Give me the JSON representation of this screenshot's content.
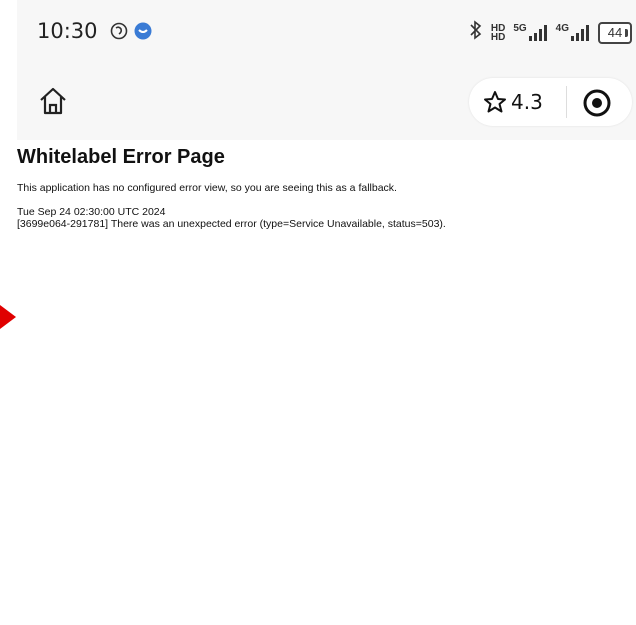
{
  "status_bar": {
    "time": "10:30",
    "hd_top": "HD",
    "hd_bottom": "HD",
    "network_5g": "5G",
    "network_4g": "4G",
    "battery": "44"
  },
  "toolbar": {
    "rating": "4.3"
  },
  "page": {
    "title": "Whitelabel Error Page",
    "description": "This application has no configured error view, so you are seeing this as a fallback.",
    "timestamp": "Tue Sep 24 02:30:00 UTC 2024",
    "error": "[3699e064-291781] There was an unexpected error (type=Service Unavailable, status=503)."
  },
  "colors": {
    "status_bg": "#f7f7f7",
    "pointer": "#e00000",
    "notification_blue": "#3a7bd5"
  }
}
